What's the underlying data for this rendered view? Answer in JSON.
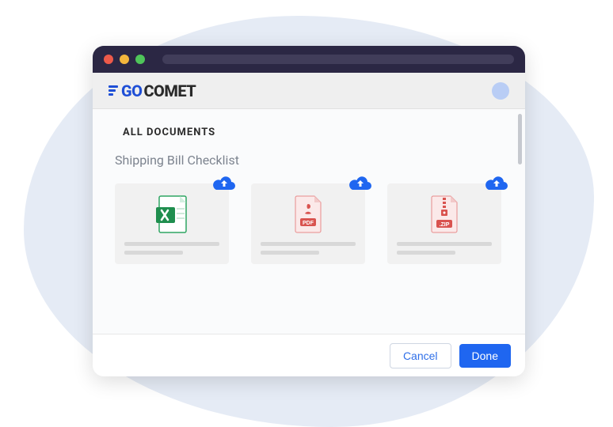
{
  "brand": {
    "part1": "GO",
    "part2": "COMET"
  },
  "section_title": "ALL DOCUMENTS",
  "subtitle": "Shipping Bill Checklist",
  "cards": [
    {
      "type": "excel"
    },
    {
      "type": "pdf"
    },
    {
      "type": "zip"
    }
  ],
  "footer": {
    "cancel": "Cancel",
    "done": "Done"
  }
}
